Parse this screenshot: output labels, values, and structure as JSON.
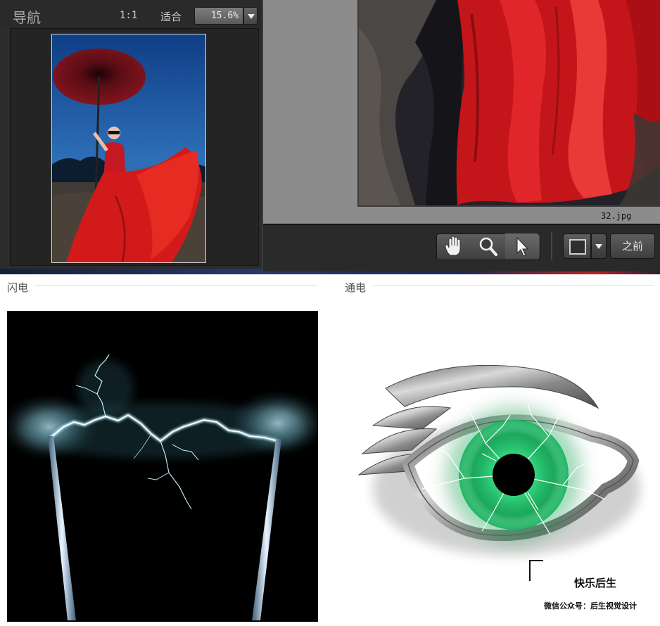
{
  "navigator": {
    "title": "导航",
    "ratio_1_1": "1:1",
    "fit_label": "适合",
    "zoom_value": "15.6%"
  },
  "photo": {
    "filename": "32.jpg"
  },
  "toolbar": {
    "tools": [
      "hand-icon",
      "zoom-icon",
      "pointer-icon"
    ],
    "before_label": "之前"
  },
  "sections": {
    "left_label": "闪电",
    "right_label": "通电"
  },
  "watermark": {
    "title": "快乐后生",
    "subtitle": "微信公众号：后生视觉设计"
  },
  "colors": {
    "panel_bg": "#2c2c2c",
    "dress_red": "#d81e1e",
    "lightning_glow": "#bfefff",
    "eye_green": "#2fd07a"
  }
}
